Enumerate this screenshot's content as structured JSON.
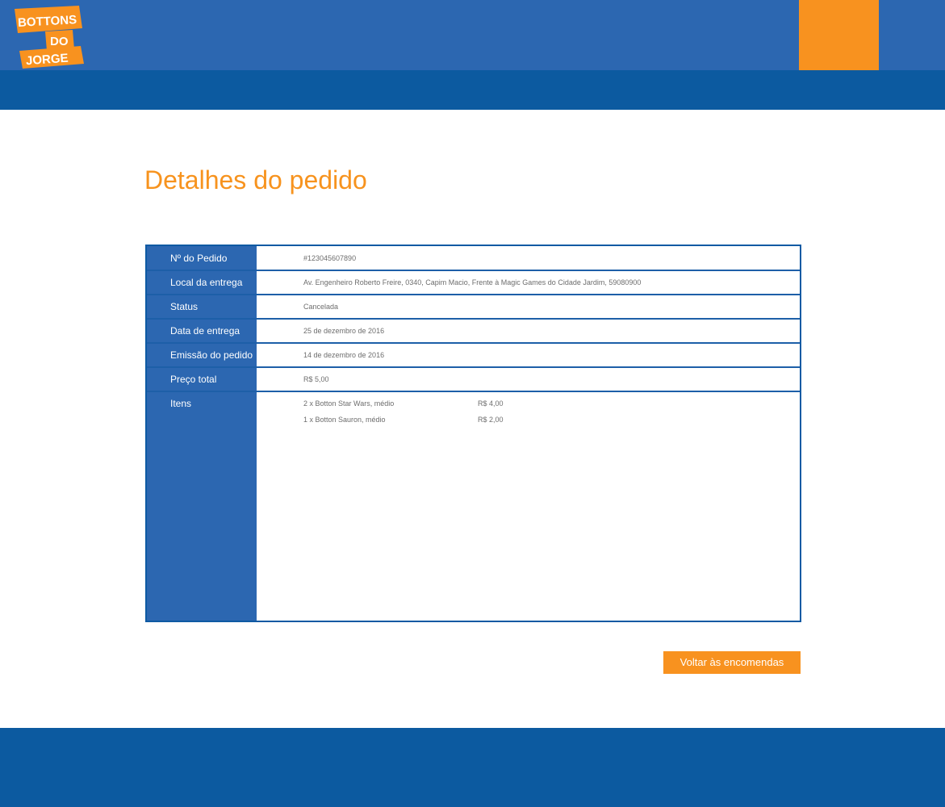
{
  "brand": {
    "logo_lines": [
      "BOTTONS",
      "DO",
      "JORGE"
    ]
  },
  "colors": {
    "header_blue": "#2c67b1",
    "nav_blue": "#0c5aa0",
    "accent_orange": "#f8921f",
    "title_orange": "#f7931e"
  },
  "page": {
    "title": "Detalhes do pedido"
  },
  "order": {
    "rows": [
      {
        "label": "Nº do Pedido",
        "value": "#123045607890"
      },
      {
        "label": "Local da entrega",
        "value": "Av. Engenheiro Roberto Freire, 0340, Capim Macio, Frente à Magic Games do Cidade Jardim, 59080900"
      },
      {
        "label": "Status",
        "value": "Cancelada"
      },
      {
        "label": "Data de entrega",
        "value": "25 de dezembro de 2016"
      },
      {
        "label": "Emissão do pedido",
        "value": "14 de dezembro de 2016"
      },
      {
        "label": "Preço total",
        "value": "R$ 5,00"
      }
    ],
    "items_label": "Itens",
    "items": [
      {
        "name": "2 x Botton Star Wars, médio",
        "price": "R$ 4,00"
      },
      {
        "name": "1 x Botton Sauron, médio",
        "price": "R$ 2,00"
      }
    ]
  },
  "actions": {
    "back_label": "Voltar às encomendas"
  }
}
